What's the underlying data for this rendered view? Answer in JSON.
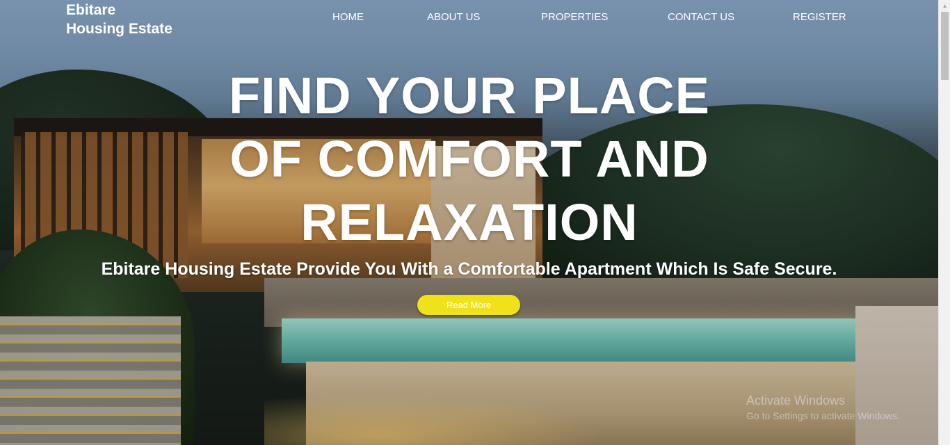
{
  "brand": {
    "line1": "Ebitare",
    "line2": "Housing Estate"
  },
  "nav": {
    "items": [
      "HOME",
      "ABOUT US",
      "PROPERTIES",
      "CONTACT US",
      "REGISTER"
    ]
  },
  "hero": {
    "headline_line1": "FIND YOUR PLACE",
    "headline_line2": "OF COMFORT AND",
    "headline_line3": "RELAXATION",
    "tagline": "Ebitare Housing Estate Provide You With a Comfortable Apartment Which Is Safe Secure.",
    "cta_label": "Read More",
    "cta_color": "#f0e21a"
  },
  "watermark": {
    "title": "Activate Windows",
    "subtitle": "Go to Settings to activate Windows."
  },
  "scrollbar": {
    "up_icon": "triangle-up",
    "position": 0
  }
}
